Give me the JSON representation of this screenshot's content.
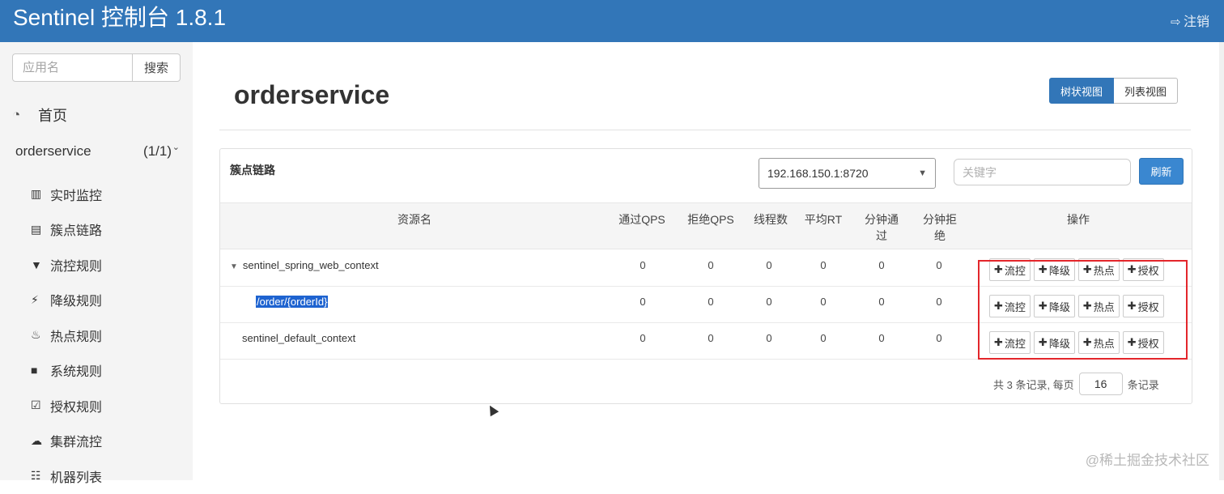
{
  "header": {
    "title": "Sentinel 控制台 1.8.1",
    "logout_label": "注销",
    "logout_icon": "sign-out-icon"
  },
  "sidebar": {
    "search_placeholder": "应用名",
    "search_button": "搜索",
    "home_label": "首页",
    "app": {
      "name": "orderservice",
      "count": "(1/1)"
    },
    "items": [
      {
        "label": "实时监控",
        "icon": "bar-chart-icon",
        "glyph": "▥"
      },
      {
        "label": "簇点链路",
        "icon": "list-alt-icon",
        "glyph": "▤"
      },
      {
        "label": "流控规则",
        "icon": "filter-icon",
        "glyph": "▼"
      },
      {
        "label": "降级规则",
        "icon": "bolt-icon",
        "glyph": "⚡"
      },
      {
        "label": "热点规则",
        "icon": "fire-icon",
        "glyph": "♨"
      },
      {
        "label": "系统规则",
        "icon": "lock-icon",
        "glyph": "■"
      },
      {
        "label": "授权规则",
        "icon": "check-square-icon",
        "glyph": "☑"
      },
      {
        "label": "集群流控",
        "icon": "cloud-icon",
        "glyph": "☁"
      },
      {
        "label": "机器列表",
        "icon": "th-list-icon",
        "glyph": "☷"
      }
    ]
  },
  "main": {
    "page_title": "orderservice",
    "view_tabs": [
      "树状视图",
      "列表视图"
    ],
    "panel_title": "簇点链路",
    "machine_selected": "192.168.150.1:8720",
    "keyword_placeholder": "关键字",
    "refresh_label": "刷新",
    "columns": [
      "资源名",
      "通过QPS",
      "拒绝QPS",
      "线程数",
      "平均RT",
      "分钟通\n过",
      "分钟拒\n绝",
      "操作"
    ],
    "rows": [
      {
        "name": "sentinel_spring_web_context",
        "pass_qps": "0",
        "block_qps": "0",
        "threads": "0",
        "avg_rt": "0",
        "min_pass": "0",
        "min_block": "0"
      },
      {
        "name": "/order/{orderId}",
        "pass_qps": "0",
        "block_qps": "0",
        "threads": "0",
        "avg_rt": "0",
        "min_pass": "0",
        "min_block": "0"
      },
      {
        "name": "sentinel_default_context",
        "pass_qps": "0",
        "block_qps": "0",
        "threads": "0",
        "avg_rt": "0",
        "min_pass": "0",
        "min_block": "0"
      }
    ],
    "op_buttons": [
      "流控",
      "降级",
      "热点",
      "授权"
    ],
    "pager": {
      "prefix": "共 3 条记录, 每页",
      "page_size": "16",
      "suffix": "条记录"
    }
  },
  "watermark": "@稀土掘金技术社区",
  "colors": {
    "header": "#3276b8",
    "primary_button": "#3a87d0",
    "highlight_box": "#e3262b"
  }
}
